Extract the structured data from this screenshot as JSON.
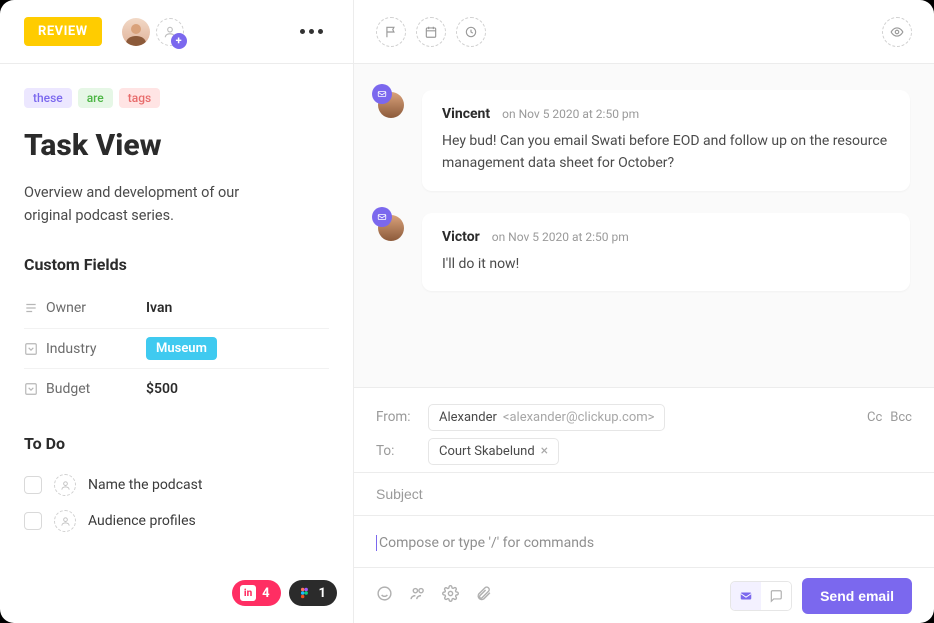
{
  "status": {
    "label": "REVIEW"
  },
  "tags": [
    {
      "text": "these",
      "cls": "tag-purple"
    },
    {
      "text": "are",
      "cls": "tag-green"
    },
    {
      "text": "tags",
      "cls": "tag-red"
    }
  ],
  "task": {
    "title": "Task View",
    "description": "Overview and development of our original podcast series."
  },
  "custom_fields": {
    "heading": "Custom Fields",
    "rows": [
      {
        "icon": "list",
        "label": "Owner",
        "value": "Ivan",
        "type": "text"
      },
      {
        "icon": "dropdown",
        "label": "Industry",
        "value": "Museum",
        "type": "pill"
      },
      {
        "icon": "dropdown",
        "label": "Budget",
        "value": "$500",
        "type": "text"
      }
    ]
  },
  "todo": {
    "heading": "To Do",
    "items": [
      {
        "label": "Name the podcast"
      },
      {
        "label": "Audience profiles"
      }
    ]
  },
  "attachments": {
    "invision_count": "4",
    "figma_count": "1"
  },
  "thread": [
    {
      "author": "Vincent",
      "timestamp": "on Nov 5 2020 at 2:50 pm",
      "body": "Hey bud! Can you email Swati before EOD and follow up on the resource management data sheet for October?"
    },
    {
      "author": "Victor",
      "timestamp": "on Nov 5 2020 at 2:50 pm",
      "body": "I'll do it now!"
    }
  ],
  "compose": {
    "from_label": "From:",
    "from_name": "Alexander",
    "from_email": "<alexander@clickup.com>",
    "to_label": "To:",
    "to_chips": [
      {
        "name": "Court Skabelund"
      }
    ],
    "cc_label": "Cc",
    "bcc_label": "Bcc",
    "subject_placeholder": "Subject",
    "body_placeholder": "Compose or type '/' for commands",
    "send_label": "Send email"
  }
}
